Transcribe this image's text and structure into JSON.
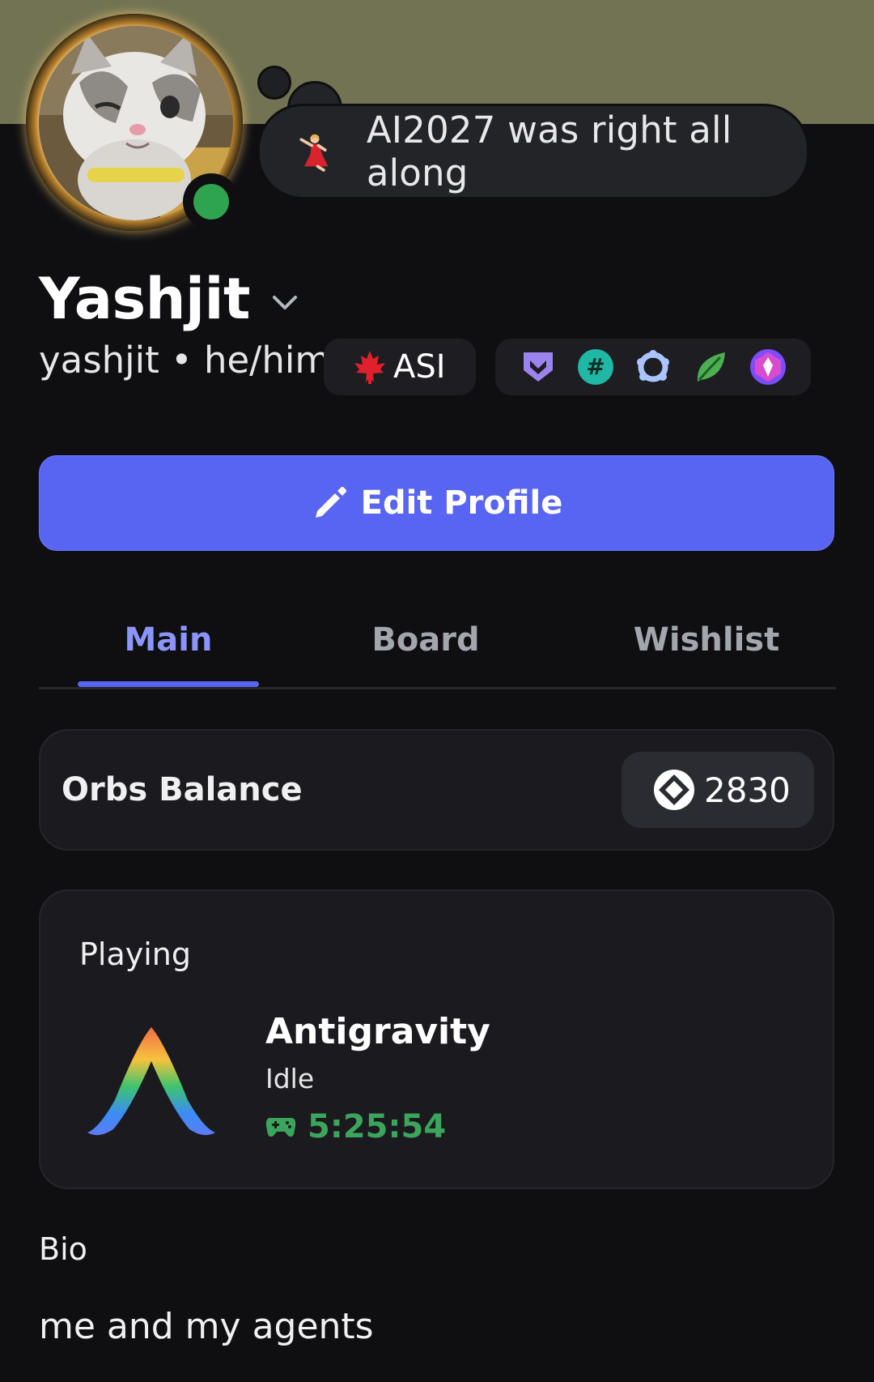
{
  "profile": {
    "status_note": "AI2027 was right all along",
    "display_name": "Yashjit",
    "username_line": "yashjit • he/him",
    "tag_text": "ASI",
    "online_color": "#2ea44f"
  },
  "actions": {
    "edit_profile_label": "Edit Profile"
  },
  "tabs": [
    {
      "label": "Main",
      "active": true
    },
    {
      "label": "Board",
      "active": false
    },
    {
      "label": "Wishlist",
      "active": false
    }
  ],
  "orbs": {
    "label": "Orbs Balance",
    "value": "2830"
  },
  "activity": {
    "heading": "Playing",
    "game_name": "Antigravity",
    "state": "Idle",
    "elapsed": "5:25:54"
  },
  "bio": {
    "heading": "Bio",
    "text": "me and my agents"
  },
  "colors": {
    "accent": "#5865f2",
    "banner": "#727353",
    "background": "#0f0f12",
    "playtime": "#3ba55c"
  }
}
